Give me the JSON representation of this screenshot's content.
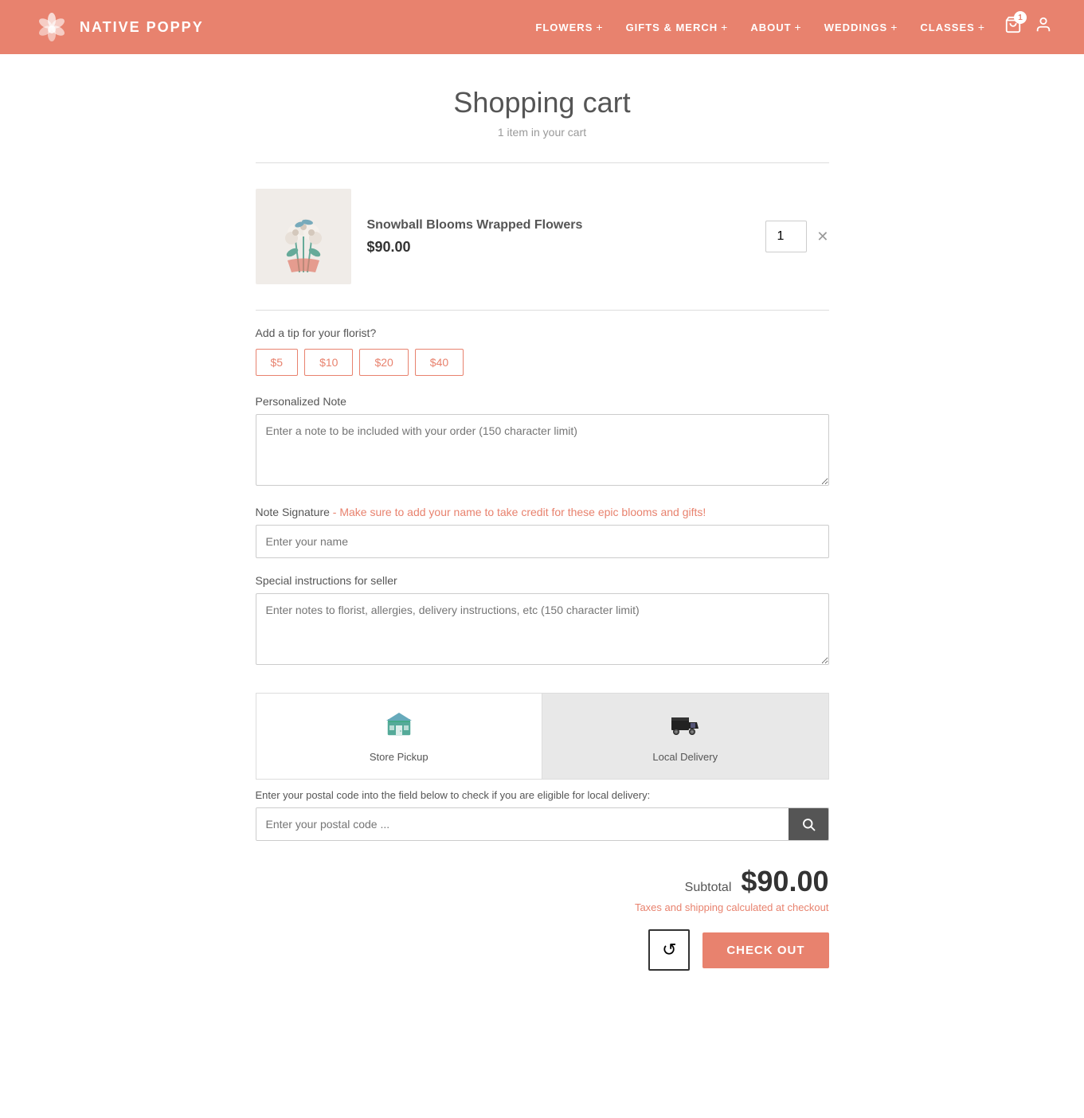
{
  "header": {
    "logo_text": "NativE POPPY",
    "nav": [
      {
        "label": "FLOWERS",
        "has_plus": true
      },
      {
        "label": "GIFTS & MERCH",
        "has_plus": true
      },
      {
        "label": "ABOUT",
        "has_plus": true
      },
      {
        "label": "WEDDINGS",
        "has_plus": true
      },
      {
        "label": "CLASSES",
        "has_plus": true
      }
    ],
    "cart_count": "1"
  },
  "page": {
    "title": "Shopping cart",
    "subtitle": "1 item in your cart"
  },
  "cart_item": {
    "name": "Snowball Blooms Wrapped Flowers",
    "price": "$90.00",
    "quantity": "1"
  },
  "tip": {
    "label": "Add a tip for your florist?",
    "options": [
      "$5",
      "$10",
      "$20",
      "$40"
    ]
  },
  "personalized_note": {
    "label": "Personalized Note",
    "placeholder": "Enter a note to be included with your order (150 character limit)"
  },
  "note_signature": {
    "label": "Note Signature",
    "highlight": " - Make sure to add your name to take credit for these epic blooms and gifts!",
    "placeholder": "Enter your name"
  },
  "special_instructions": {
    "label": "Special instructions for seller",
    "placeholder": "Enter notes to florist, allergies, delivery instructions, etc (150 character limit)"
  },
  "delivery": {
    "store_pickup_label": "Store Pickup",
    "local_delivery_label": "Local Delivery",
    "postal_note": "Enter your postal code into the field below to check if you are eligible for local delivery:",
    "postal_placeholder": "Enter your postal code ..."
  },
  "summary": {
    "subtotal_label": "Subtotal",
    "subtotal_amount": "$90.00",
    "tax_note": "Taxes and shipping calculated at checkout"
  },
  "actions": {
    "refresh_icon": "↺",
    "checkout_label": "CHECK OUT"
  }
}
